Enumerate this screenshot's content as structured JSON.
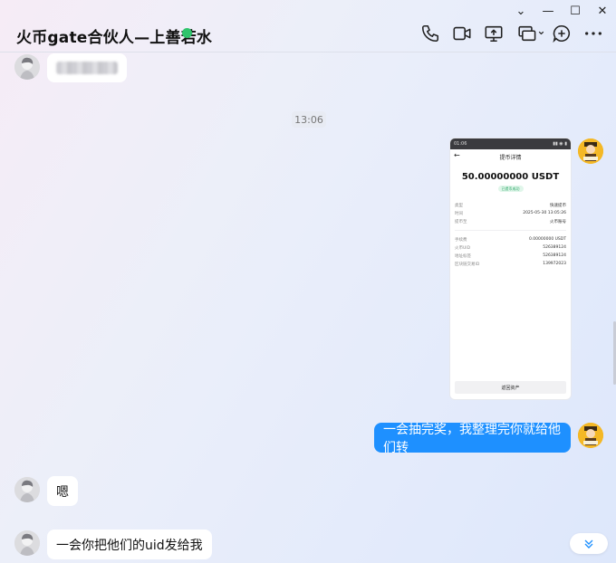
{
  "window_controls": {
    "collapse": "⌄",
    "minimize": "—",
    "maximize": "☐",
    "close": "✕"
  },
  "header": {
    "title": "火币gate合伙人—上善若水",
    "status_color": "#2fc46c"
  },
  "toolbar_icons": [
    "phone-icon",
    "video-icon",
    "screen-share-icon",
    "remote-control-icon",
    "add-icon",
    "more-icon"
  ],
  "chat": {
    "timestamp": "13:06",
    "messages": {
      "m1": {
        "text": ""
      },
      "m3": {
        "text": "一会抽完奖，我整理完你就给他们转"
      },
      "m4": {
        "text": "嗯"
      },
      "m5": {
        "text": "一会你把他们的uid发给我"
      }
    }
  },
  "screenshot": {
    "status_time": "01:06",
    "nav_title": "提币详情",
    "amount": "50.00000000 USDT",
    "tag": "已提币成功",
    "rows1": [
      {
        "k": "类型",
        "v": "快速提币"
      },
      {
        "k": "时间",
        "v": "2025-05-30 13:05:26"
      },
      {
        "k": "提币至",
        "v": "火币账号"
      }
    ],
    "rows2": [
      {
        "k": "手续费",
        "v": "0.00000000 USDT"
      },
      {
        "k": "火币UID",
        "v": "526389124"
      },
      {
        "k": "地址标签",
        "v": "526389124"
      },
      {
        "k": "区块链交易ID",
        "v": "139972023"
      }
    ],
    "button": "返回资产"
  },
  "colors": {
    "accent": "#1e90ff",
    "online": "#2fc46c"
  }
}
